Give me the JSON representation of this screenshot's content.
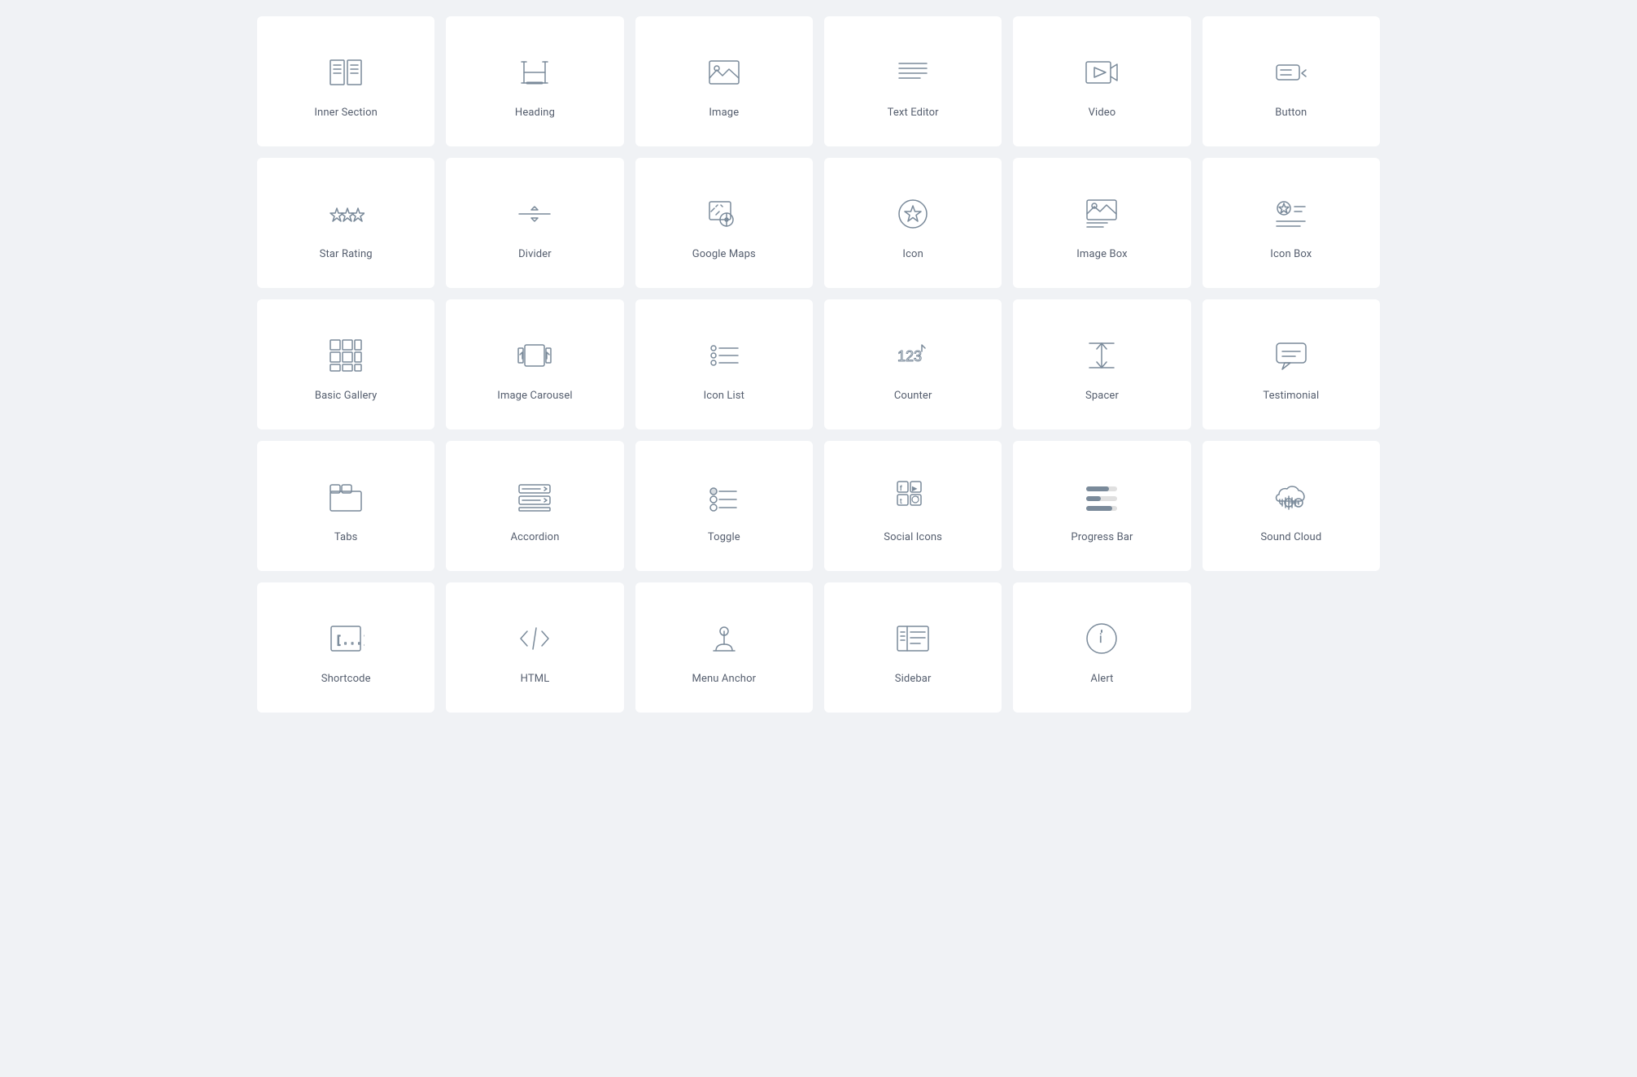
{
  "widgets": [
    {
      "id": "inner-section",
      "label": "Inner Section",
      "icon": "inner-section"
    },
    {
      "id": "heading",
      "label": "Heading",
      "icon": "heading"
    },
    {
      "id": "image",
      "label": "Image",
      "icon": "image"
    },
    {
      "id": "text-editor",
      "label": "Text Editor",
      "icon": "text-editor"
    },
    {
      "id": "video",
      "label": "Video",
      "icon": "video"
    },
    {
      "id": "button",
      "label": "Button",
      "icon": "button"
    },
    {
      "id": "star-rating",
      "label": "Star Rating",
      "icon": "star-rating"
    },
    {
      "id": "divider",
      "label": "Divider",
      "icon": "divider"
    },
    {
      "id": "google-maps",
      "label": "Google Maps",
      "icon": "google-maps"
    },
    {
      "id": "icon",
      "label": "Icon",
      "icon": "icon"
    },
    {
      "id": "image-box",
      "label": "Image Box",
      "icon": "image-box"
    },
    {
      "id": "icon-box",
      "label": "Icon Box",
      "icon": "icon-box"
    },
    {
      "id": "basic-gallery",
      "label": "Basic Gallery",
      "icon": "basic-gallery"
    },
    {
      "id": "image-carousel",
      "label": "Image Carousel",
      "icon": "image-carousel"
    },
    {
      "id": "icon-list",
      "label": "Icon List",
      "icon": "icon-list"
    },
    {
      "id": "counter",
      "label": "Counter",
      "icon": "counter"
    },
    {
      "id": "spacer",
      "label": "Spacer",
      "icon": "spacer"
    },
    {
      "id": "testimonial",
      "label": "Testimonial",
      "icon": "testimonial"
    },
    {
      "id": "tabs",
      "label": "Tabs",
      "icon": "tabs"
    },
    {
      "id": "accordion",
      "label": "Accordion",
      "icon": "accordion"
    },
    {
      "id": "toggle",
      "label": "Toggle",
      "icon": "toggle"
    },
    {
      "id": "social-icons",
      "label": "Social Icons",
      "icon": "social-icons"
    },
    {
      "id": "progress-bar",
      "label": "Progress Bar",
      "icon": "progress-bar"
    },
    {
      "id": "sound-cloud",
      "label": "Sound Cloud",
      "icon": "sound-cloud"
    },
    {
      "id": "shortcode",
      "label": "Shortcode",
      "icon": "shortcode"
    },
    {
      "id": "html",
      "label": "HTML",
      "icon": "html"
    },
    {
      "id": "menu-anchor",
      "label": "Menu Anchor",
      "icon": "menu-anchor"
    },
    {
      "id": "sidebar",
      "label": "Sidebar",
      "icon": "sidebar"
    },
    {
      "id": "alert",
      "label": "Alert",
      "icon": "alert"
    }
  ]
}
